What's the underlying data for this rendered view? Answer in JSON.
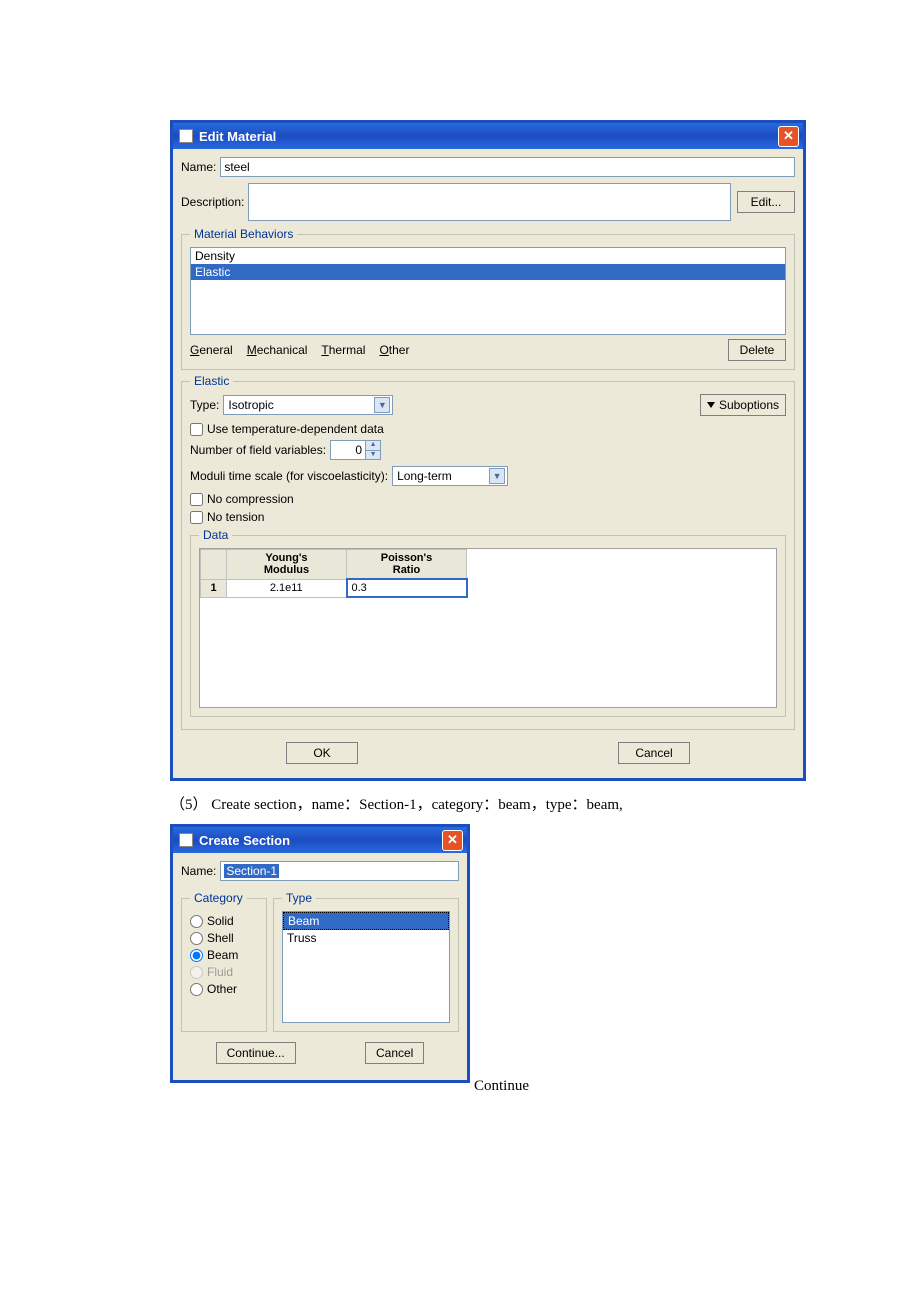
{
  "editMaterial": {
    "title": "Edit Material",
    "nameLabel": "Name:",
    "nameValue": "steel",
    "descLabel": "Description:",
    "descValue": "",
    "editBtn": "Edit...",
    "behaviorsLegend": "Material Behaviors",
    "behaviorItems": [
      "Density",
      "Elastic"
    ],
    "behaviorSelectedIndex": 1,
    "menus": {
      "general": "General",
      "mechanical": "Mechanical",
      "thermal": "Thermal",
      "other": "Other"
    },
    "deleteBtn": "Delete",
    "elasticLegend": "Elastic",
    "typeLabel": "Type:",
    "typeValue": "Isotropic",
    "suboptions": "Suboptions",
    "tempDep": "Use temperature-dependent data",
    "fieldVarsLabel": "Number of field variables:",
    "fieldVarsValue": "0",
    "moduliLabel": "Moduli time scale (for viscoelasticity):",
    "moduliValue": "Long-term",
    "noCompression": "No compression",
    "noTension": "No tension",
    "dataLegend": "Data",
    "col1": "Young's\nModulus",
    "col2": "Poisson's\nRatio",
    "row": {
      "num": "1",
      "youngs": "2.1e11",
      "poisson": "0.3"
    },
    "okBtn": "OK",
    "cancelBtn": "Cancel"
  },
  "caption5": "（5）  Create section，name：Section-1，category：beam，type：beam,",
  "createSection": {
    "title": "Create Section",
    "nameLabel": "Name:",
    "nameValue": "Section-1",
    "categoryLegend": "Category",
    "categories": [
      "Solid",
      "Shell",
      "Beam",
      "Fluid",
      "Other"
    ],
    "categorySelected": "Beam",
    "categoryDisabled": "Fluid",
    "typeLegend": "Type",
    "types": [
      "Beam",
      "Truss"
    ],
    "typeSelected": "Beam",
    "continueBtn": "Continue...",
    "cancelBtn": "Cancel"
  },
  "continueText": "Continue"
}
